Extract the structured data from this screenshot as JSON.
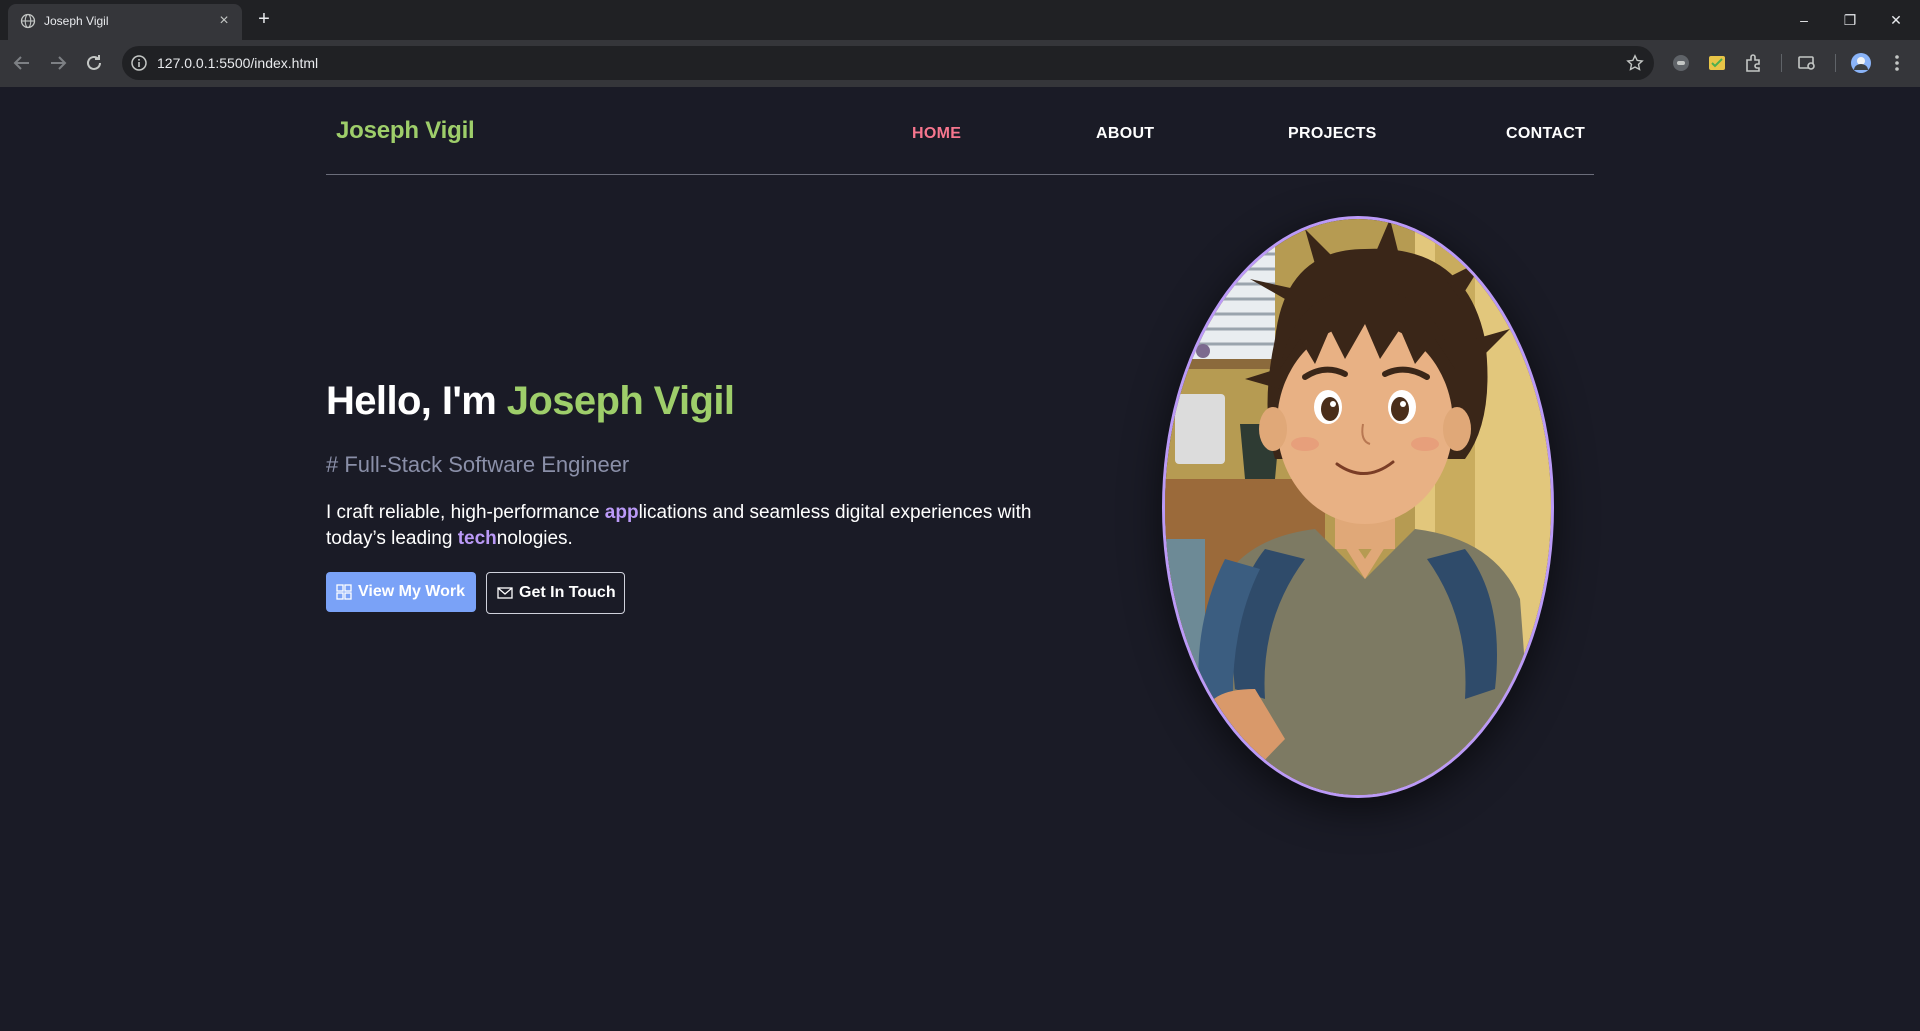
{
  "browser": {
    "tab_title": "Joseph Vigil",
    "url": "127.0.0.1:5500/index.html",
    "new_tab_symbol": "+",
    "close_symbol": "×",
    "window_controls": {
      "minimize": "–",
      "restore": "❐",
      "close": "✕"
    }
  },
  "site": {
    "brand": "Joseph Vigil",
    "nav": [
      {
        "label": "HOME",
        "active": true
      },
      {
        "label": "ABOUT",
        "active": false
      },
      {
        "label": "PROJECTS",
        "active": false
      },
      {
        "label": "CONTACT",
        "active": false
      }
    ]
  },
  "hero": {
    "greeting": "Hello, I'm ",
    "name": "Joseph Vigil",
    "subtitle": "# Full-Stack Software Engineer",
    "desc_part1": "I craft reliable, high-performance ",
    "desc_hl1": "app",
    "desc_part2": "lications and seamless digital experiences with today’s leading ",
    "desc_hl2": "tech",
    "desc_part3": "nologies.",
    "primary_button": "View My Work",
    "secondary_button": "Get In Touch"
  },
  "colors": {
    "background": "#1a1b26",
    "brand_green": "#9ece6a",
    "nav_active": "#f7768e",
    "accent_purple": "#bb9af7",
    "button_blue": "#7aa2f7"
  },
  "icons": [
    "globe-icon",
    "back-icon",
    "forward-icon",
    "reload-icon",
    "info-icon",
    "star-icon",
    "extension-icon",
    "grid-icon",
    "mail-icon"
  ]
}
